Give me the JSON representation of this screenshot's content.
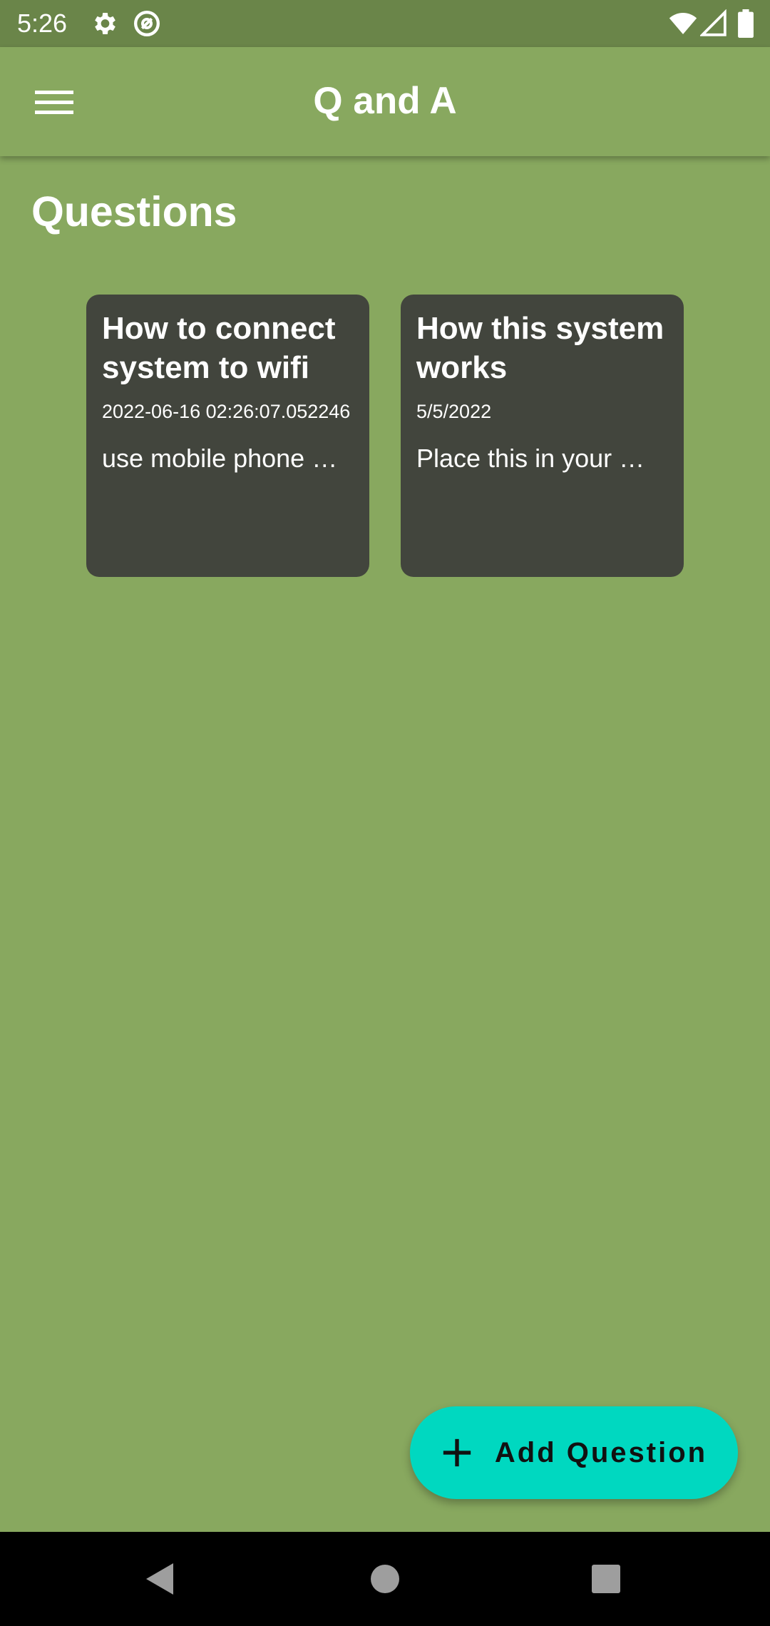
{
  "status_bar": {
    "time": "5:26",
    "icons": [
      "gear-icon",
      "at-sign-icon",
      "wifi-icon",
      "cellular-signal-icon",
      "battery-icon"
    ]
  },
  "app_bar": {
    "title": "Q and A",
    "menu_icon": "hamburger-menu-icon"
  },
  "page": {
    "heading": "Questions"
  },
  "questions": [
    {
      "title": "How to connect system to wifi",
      "date": "2022-06-16 02:26:07.052246",
      "snippet": "use mobile phone …"
    },
    {
      "title": "How this system works",
      "date": "5/5/2022",
      "snippet": "Place this in your …"
    }
  ],
  "fab": {
    "label": "Add Question",
    "icon": "plus-icon"
  },
  "navigation": {
    "icons": [
      "back-icon",
      "home-icon",
      "recents-icon"
    ]
  },
  "colors": {
    "background": "#88a85f",
    "status_bar": "#6a8549",
    "card": "#42453d",
    "fab": "#00d8c0",
    "nav_bar": "#000000"
  }
}
